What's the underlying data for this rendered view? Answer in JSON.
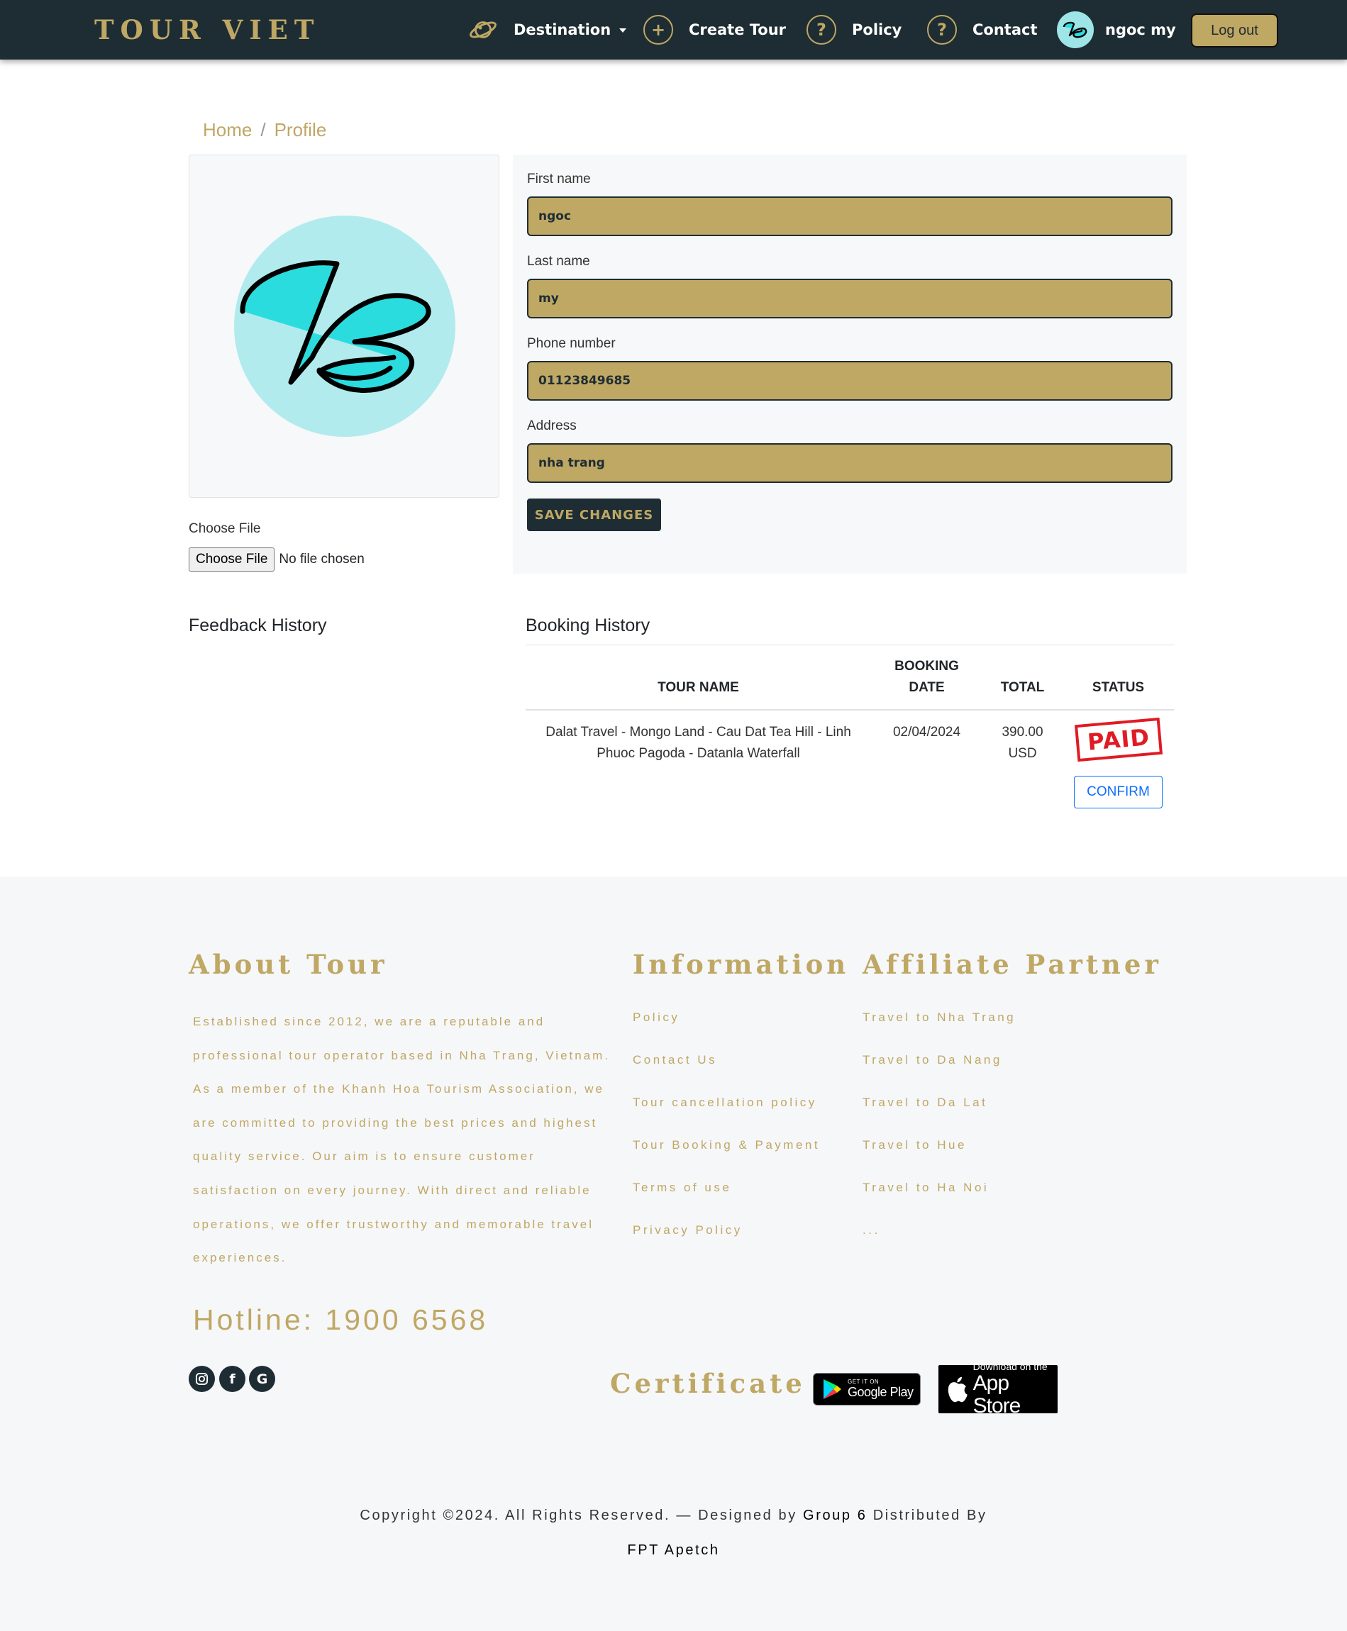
{
  "nav": {
    "brand": "TOUR VIET",
    "destination": "Destination",
    "create_tour": "Create Tour",
    "policy": "Policy",
    "contact": "Contact",
    "user_name": "ngoc my",
    "logout": "Log out",
    "icons": {
      "destination": "planet-icon",
      "create": "plus-circle-icon",
      "policy": "question-circle-icon",
      "contact": "question-circle-icon"
    }
  },
  "breadcrumb": {
    "home": "Home",
    "separator": "/",
    "current": "Profile"
  },
  "avatar": {
    "file_label": "Choose File",
    "file_button": "Choose File",
    "file_status": "No file chosen"
  },
  "form": {
    "first_name_label": "First name",
    "first_name": "ngoc",
    "last_name_label": "Last name",
    "last_name": "my",
    "phone_label": "Phone number",
    "phone": "01123849685",
    "address_label": "Address",
    "address": "nha trang",
    "save": "SAVE CHANGES"
  },
  "feedback": {
    "title": "Feedback History"
  },
  "booking": {
    "title": "Booking History",
    "headers": {
      "tour": "TOUR NAME",
      "date_1": "BOOKING",
      "date_2": "DATE",
      "total": "TOTAL",
      "status": "STATUS"
    },
    "rows": [
      {
        "tour_1": "Dalat Travel - Mongo Land - Cau Dat Tea Hill - Linh",
        "tour_2": "Phuoc Pagoda - Datanla Waterfall",
        "date": "02/04/2024",
        "total_1": "390.00",
        "total_2": "USD",
        "status": "PAID",
        "action": "CONFIRM"
      }
    ]
  },
  "footer": {
    "about_title": "About Tour",
    "about_text": "Established since 2012, we are a reputable and professional tour operator based in Nha Trang, Vietnam. As a member of the Khanh Hoa Tourism Association, we are committed to providing the best prices and highest quality service. Our aim is to ensure customer satisfaction on every journey. With direct and reliable operations, we offer trustworthy and memorable travel experiences.",
    "hotline": "Hotline: 1900 6568",
    "info_title": "Information",
    "info_links": [
      "Policy",
      "Contact Us",
      "Tour cancellation policy",
      "Tour Booking & Payment",
      "Terms of use",
      "Privacy Policy"
    ],
    "partner_title": "Affiliate Partner",
    "partner_links": [
      "Travel to Nha Trang",
      "Travel to Da Nang",
      "Travel to Da Lat",
      "Travel to Hue",
      "Travel to Ha Noi",
      "..."
    ],
    "certificate_title": "Certificate",
    "google_small": "GET IT ON",
    "google_big": "Google Play",
    "apple_small": "Download on the",
    "apple_big": "App Store",
    "social": [
      "instagram-icon",
      "facebook-icon",
      "google-icon"
    ],
    "copyright_1": "Copyright ©2024. All Rights Reserved. — Designed by",
    "designer": "Group 6",
    "copyright_2": "Distributed By",
    "distributor": "FPT Apetch"
  },
  "colors": {
    "navy": "#1e2d33",
    "gold": "#bfa764",
    "avatar_bg": "#b1ebed",
    "accent_cyan": "#2bdcdf",
    "paid_red": "#e01b24",
    "confirm_blue": "#0d6efd"
  }
}
